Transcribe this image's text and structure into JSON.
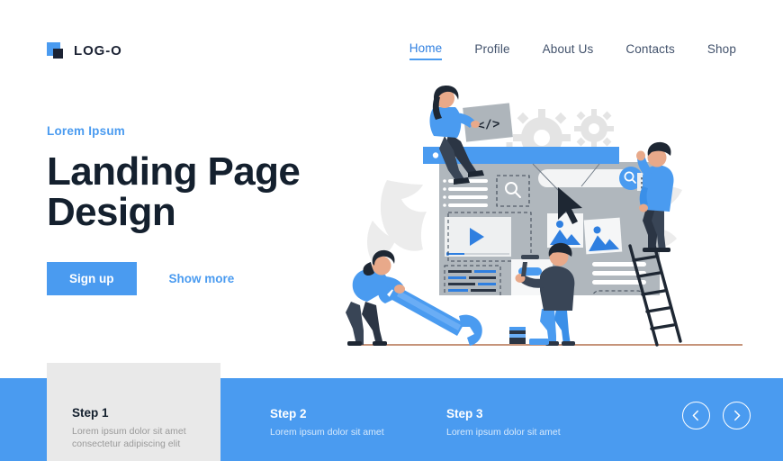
{
  "header": {
    "brand_name": "LOG-O",
    "nav": [
      {
        "label": "Home",
        "active": true
      },
      {
        "label": "Profile",
        "active": false
      },
      {
        "label": "About Us",
        "active": false
      },
      {
        "label": "Contacts",
        "active": false
      },
      {
        "label": "Shop",
        "active": false
      }
    ]
  },
  "hero": {
    "eyebrow": "Lorem Ipsum",
    "title_line1": "Landing Page",
    "title_line2": "Design",
    "primary_button": "Sign up",
    "secondary_button": "Show more"
  },
  "illustration": {
    "code_glyph": "</>",
    "alt": "people building a website on a large browser mockup"
  },
  "steps": [
    {
      "title": "Step 1",
      "desc": "Lorem ipsum dolor sit amet consectetur adipiscing elit",
      "active": true
    },
    {
      "title": "Step 2",
      "desc": "Lorem ipsum dolor sit amet",
      "active": false
    },
    {
      "title": "Step 3",
      "desc": "Lorem ipsum dolor sit amet",
      "active": false
    }
  ],
  "carousel": {
    "prev_label": "Previous",
    "next_label": "Next"
  },
  "colors": {
    "accent_blue": "#4a9bf0",
    "dark_navy": "#14202e",
    "step_active_bg": "#e9e9e9",
    "nav_text": "#41516b"
  }
}
